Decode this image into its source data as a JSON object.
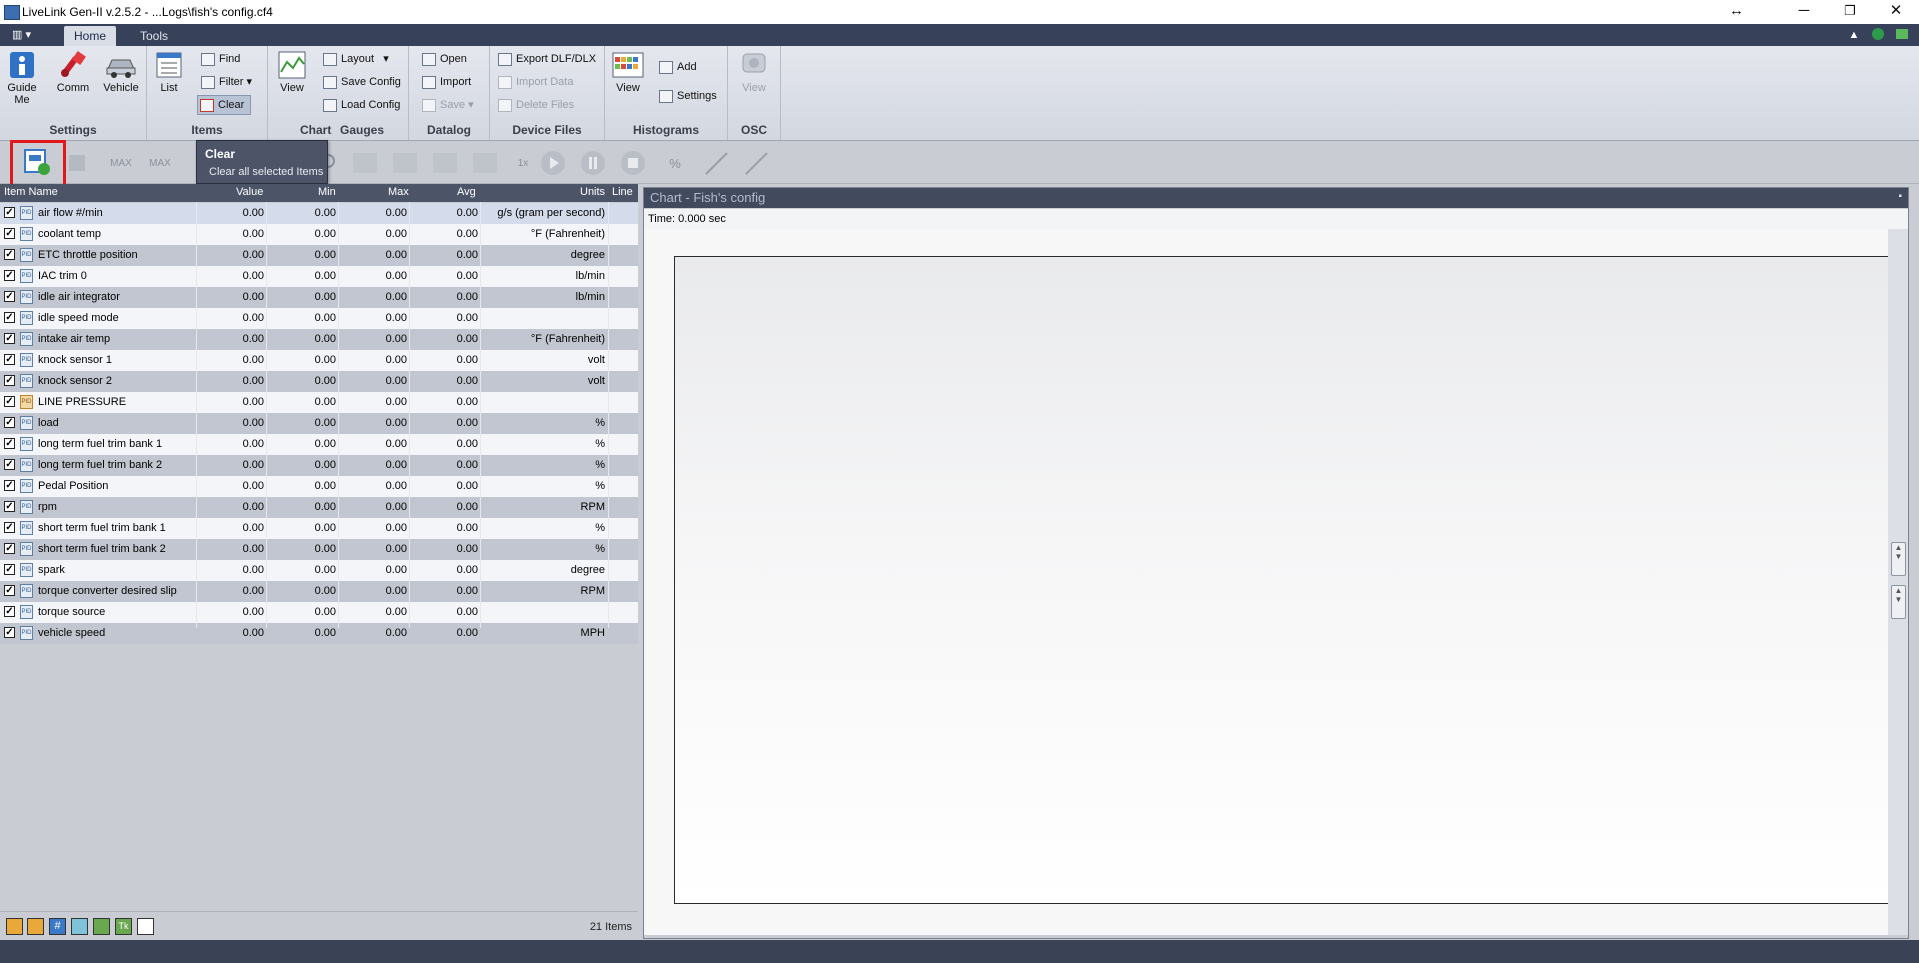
{
  "window": {
    "title": "LiveLink Gen-II  v.2.5.2 - ...Logs\\fish's config.cf4",
    "resize_glyph": "↔",
    "min_glyph": "─",
    "max_glyph": "❐",
    "close_glyph": "✕"
  },
  "ribbon": {
    "tabs": [
      "Home",
      "Tools"
    ],
    "active_tab": "Home",
    "qat_glyph": "▥ ▾",
    "groups": {
      "settings": {
        "label": "Settings",
        "guide_me": "Guide Me",
        "comm": "Comm",
        "vehicle": "Vehicle"
      },
      "items": {
        "label": "Items",
        "list": "List",
        "find": "Find",
        "filter": "Filter",
        "clear": "Clear"
      },
      "chart": {
        "label": "Chart",
        "view": "View",
        "layout": "Layout",
        "save_config": "Save Config",
        "load_config": "Load Config"
      },
      "gauges": {
        "label": "Gauges"
      },
      "datalog": {
        "label": "Datalog",
        "open": "Open",
        "import": "Import",
        "save": "Save"
      },
      "device_files": {
        "label": "Device Files",
        "export": "Export DLF/DLX",
        "import_data": "Import Data",
        "delete_files": "Delete Files"
      },
      "histograms": {
        "label": "Histograms",
        "view": "View",
        "add": "Add",
        "settings": "Settings"
      },
      "osc": {
        "label": "OSC",
        "view": "View"
      }
    }
  },
  "toolbar": {
    "speed_label": "1x",
    "max_label": "MAX",
    "percent_label": "%"
  },
  "tooltip": {
    "title": "Clear",
    "description": "Clear all selected Items"
  },
  "grid": {
    "columns": [
      "Item Name",
      "Value",
      "Min",
      "Max",
      "Avg",
      "Units",
      "Line"
    ],
    "rows": [
      {
        "name": "air flow #/min",
        "value": "0.00",
        "min": "0.00",
        "max": "0.00",
        "avg": "0.00",
        "units": "g/s (gram per second)",
        "type": "pid"
      },
      {
        "name": "coolant temp",
        "value": "0.00",
        "min": "0.00",
        "max": "0.00",
        "avg": "0.00",
        "units": "°F (Fahrenheit)",
        "type": "pid"
      },
      {
        "name": "ETC throttle position",
        "value": "0.00",
        "min": "0.00",
        "max": "0.00",
        "avg": "0.00",
        "units": "degree",
        "type": "pid"
      },
      {
        "name": "IAC trim 0",
        "value": "0.00",
        "min": "0.00",
        "max": "0.00",
        "avg": "0.00",
        "units": "lb/min",
        "type": "pid"
      },
      {
        "name": "idle air integrator",
        "value": "0.00",
        "min": "0.00",
        "max": "0.00",
        "avg": "0.00",
        "units": "lb/min",
        "type": "pid"
      },
      {
        "name": "idle speed mode",
        "value": "0.00",
        "min": "0.00",
        "max": "0.00",
        "avg": "0.00",
        "units": "",
        "type": "pid"
      },
      {
        "name": "intake air temp",
        "value": "0.00",
        "min": "0.00",
        "max": "0.00",
        "avg": "0.00",
        "units": "°F (Fahrenheit)",
        "type": "pid"
      },
      {
        "name": "knock sensor 1",
        "value": "0.00",
        "min": "0.00",
        "max": "0.00",
        "avg": "0.00",
        "units": "volt",
        "type": "pid"
      },
      {
        "name": "knock sensor 2",
        "value": "0.00",
        "min": "0.00",
        "max": "0.00",
        "avg": "0.00",
        "units": "volt",
        "type": "pid"
      },
      {
        "name": "LINE PRESSURE",
        "value": "0.00",
        "min": "0.00",
        "max": "0.00",
        "avg": "0.00",
        "units": "",
        "type": "orange"
      },
      {
        "name": "load",
        "value": "0.00",
        "min": "0.00",
        "max": "0.00",
        "avg": "0.00",
        "units": "%",
        "type": "pid"
      },
      {
        "name": "long term fuel trim bank 1",
        "value": "0.00",
        "min": "0.00",
        "max": "0.00",
        "avg": "0.00",
        "units": "%",
        "type": "pid"
      },
      {
        "name": "long term fuel trim bank 2",
        "value": "0.00",
        "min": "0.00",
        "max": "0.00",
        "avg": "0.00",
        "units": "%",
        "type": "pid"
      },
      {
        "name": "Pedal Position",
        "value": "0.00",
        "min": "0.00",
        "max": "0.00",
        "avg": "0.00",
        "units": "%",
        "type": "pid"
      },
      {
        "name": "rpm",
        "value": "0.00",
        "min": "0.00",
        "max": "0.00",
        "avg": "0.00",
        "units": "RPM",
        "type": "pid"
      },
      {
        "name": "short term fuel trim bank 1",
        "value": "0.00",
        "min": "0.00",
        "max": "0.00",
        "avg": "0.00",
        "units": "%",
        "type": "pid"
      },
      {
        "name": "short term fuel trim bank 2",
        "value": "0.00",
        "min": "0.00",
        "max": "0.00",
        "avg": "0.00",
        "units": "%",
        "type": "pid"
      },
      {
        "name": "spark",
        "value": "0.00",
        "min": "0.00",
        "max": "0.00",
        "avg": "0.00",
        "units": "degree",
        "type": "pid"
      },
      {
        "name": "torque converter desired slip",
        "value": "0.00",
        "min": "0.00",
        "max": "0.00",
        "avg": "0.00",
        "units": "RPM",
        "type": "pid"
      },
      {
        "name": "torque source",
        "value": "0.00",
        "min": "0.00",
        "max": "0.00",
        "avg": "0.00",
        "units": "",
        "type": "pid"
      },
      {
        "name": "vehicle speed",
        "value": "0.00",
        "min": "0.00",
        "max": "0.00",
        "avg": "0.00",
        "units": "MPH",
        "type": "pid"
      }
    ],
    "footer_icon_glyphs": [
      "",
      "",
      "#",
      "",
      "",
      "Tk",
      ""
    ],
    "item_count": "21 Items",
    "pid_badge": "PID",
    "checkmark": "✓"
  },
  "chart": {
    "title": "Chart - Fish's config",
    "pin_glyph": "▪",
    "time_label": "Time: 0.000 sec"
  },
  "colors": {
    "ribbon_dark": "#37415a",
    "highlight_box": "#e0181c",
    "header_dark": "#4c5468",
    "chart_title_bg": "#424a5e"
  }
}
